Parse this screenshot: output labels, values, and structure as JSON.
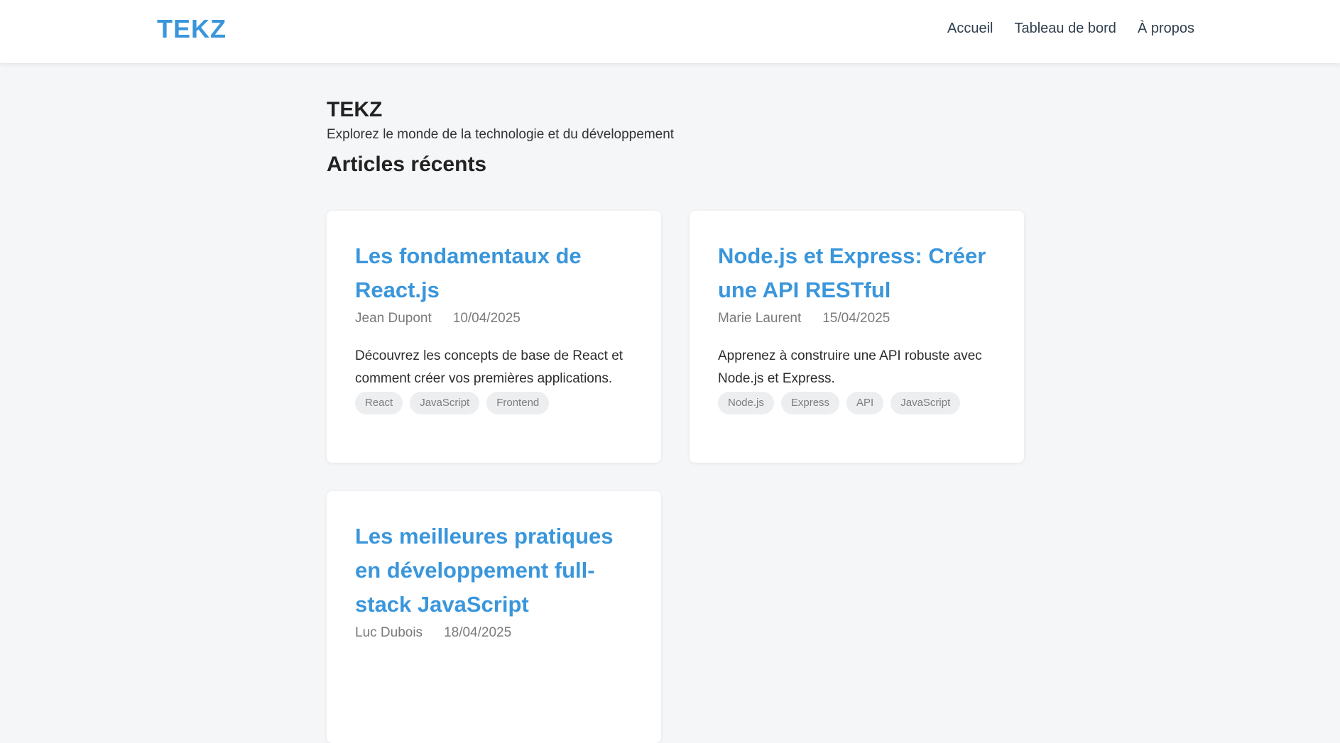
{
  "navbar": {
    "logo": "TEKZ",
    "links": [
      "Accueil",
      "Tableau de bord",
      "À propos"
    ]
  },
  "header": {
    "site_title": "TEKZ",
    "subtitle": "Explorez le monde de la technologie et du développement",
    "section_title": "Articles récents"
  },
  "articles": [
    {
      "title": "Les fondamentaux de React.js",
      "author": "Jean Dupont",
      "date": "10/04/2025",
      "description": "Découvrez les concepts de base de React et comment créer vos premières applications.",
      "tags": [
        "React",
        "JavaScript",
        "Frontend"
      ]
    },
    {
      "title": "Node.js et Express: Créer une API RESTful",
      "author": "Marie Laurent",
      "date": "15/04/2025",
      "description": "Apprenez à construire une API robuste avec Node.js et Express.",
      "tags": [
        "Node.js",
        "Express",
        "API",
        "JavaScript"
      ]
    },
    {
      "title": "Les meilleures pratiques en développement full-stack JavaScript",
      "author": "Luc Dubois",
      "date": "18/04/2025",
      "description": "",
      "tags": []
    }
  ],
  "colors": {
    "accent": "#3a96db",
    "background": "#f5f6f8",
    "card": "#ffffff",
    "tag_bg": "#eceef0"
  }
}
